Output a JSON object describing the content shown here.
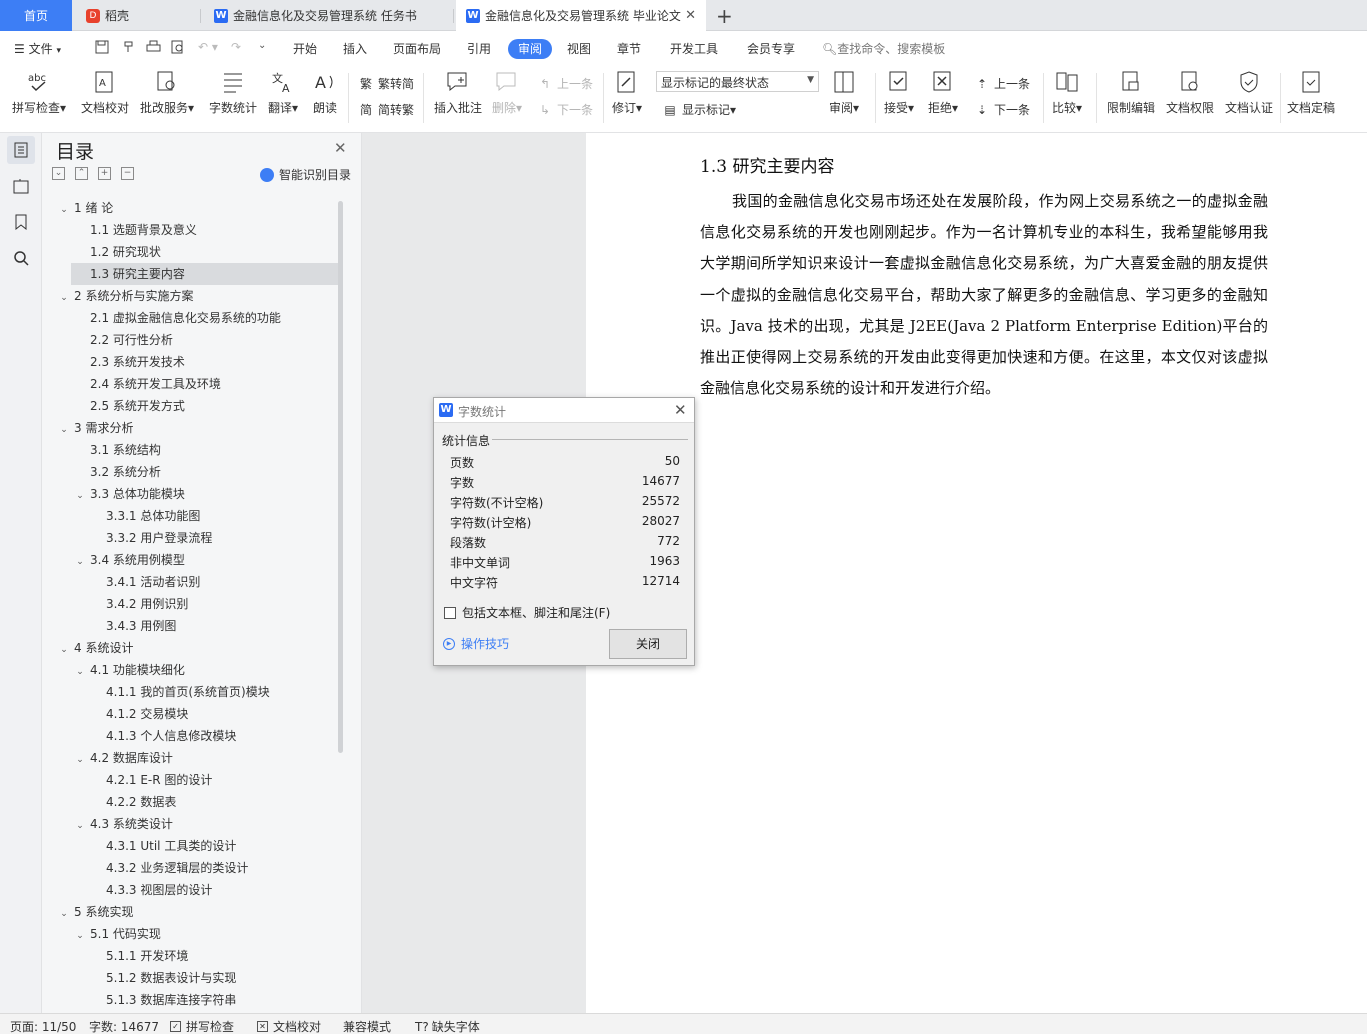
{
  "tabs": {
    "home": "首页",
    "daoke": "稻壳",
    "doc1": "金融信息化及交易管理系统 任务书",
    "doc2": "金融信息化及交易管理系统 毕业论文",
    "add": "+",
    "close": "✕"
  },
  "menu": {
    "file": "文件",
    "items": [
      "开始",
      "插入",
      "页面布局",
      "引用",
      "审阅",
      "视图",
      "章节",
      "开发工具",
      "会员专享"
    ],
    "search": "查找命令、搜索模板"
  },
  "ribbon": {
    "spell": "拼写检查",
    "proof": "文档校对",
    "batch": "批改服务",
    "wordcount": "字数统计",
    "translate": "翻译",
    "read": "朗读",
    "trad": "繁转简",
    "simp": "简转繁",
    "insert_comment": "插入批注",
    "delete": "删除",
    "prev1": "上一条",
    "next1": "下一条",
    "revise": "修订",
    "display_state": "显示标记的最终状态",
    "show_marks": "显示标记",
    "review": "审阅",
    "accept": "接受",
    "reject": "拒绝",
    "prev2": "上一条",
    "next2": "下一条",
    "compare": "比较",
    "restrict": "限制编辑",
    "perm": "文档权限",
    "cert": "文档认证",
    "final": "文档定稿"
  },
  "toc": {
    "title": "目录",
    "smart": "智能识别目录",
    "items": [
      {
        "text": "1  绪  论",
        "level": 1,
        "caret": true
      },
      {
        "text": "1.1  选题背景及意义",
        "level": 2
      },
      {
        "text": "1.2  研究现状",
        "level": 2
      },
      {
        "text": "1.3  研究主要内容",
        "level": 2,
        "selected": true
      },
      {
        "text": "2  系统分析与实施方案",
        "level": 1,
        "caret": true
      },
      {
        "text": "2.1  虚拟金融信息化交易系统的功能",
        "level": 2
      },
      {
        "text": "2.2  可行性分析",
        "level": 2
      },
      {
        "text": "2.3  系统开发技术",
        "level": 2
      },
      {
        "text": "2.4  系统开发工具及环境",
        "level": 2
      },
      {
        "text": "2.5  系统开发方式",
        "level": 2
      },
      {
        "text": "3  需求分析",
        "level": 1,
        "caret": true
      },
      {
        "text": "3.1  系统结构",
        "level": 2
      },
      {
        "text": "3.2  系统分析",
        "level": 2
      },
      {
        "text": "3.3  总体功能模块",
        "level": 2,
        "caret": true
      },
      {
        "text": "3.3.1  总体功能图",
        "level": 3
      },
      {
        "text": "3.3.2  用户登录流程",
        "level": 3
      },
      {
        "text": "3.4  系统用例模型",
        "level": 2,
        "caret": true
      },
      {
        "text": "3.4.1  活动者识别",
        "level": 3
      },
      {
        "text": "3.4.2  用例识别",
        "level": 3
      },
      {
        "text": "3.4.3  用例图",
        "level": 3
      },
      {
        "text": "4  系统设计",
        "level": 1,
        "caret": true
      },
      {
        "text": "4.1  功能模块细化",
        "level": 2,
        "caret": true
      },
      {
        "text": "4.1.1  我的首页(系统首页)模块",
        "level": 3
      },
      {
        "text": "4.1.2  交易模块",
        "level": 3
      },
      {
        "text": "4.1.3  个人信息修改模块",
        "level": 3
      },
      {
        "text": "4.2  数据库设计",
        "level": 2,
        "caret": true
      },
      {
        "text": "4.2.1 E-R 图的设计",
        "level": 3
      },
      {
        "text": "4.2.2  数据表",
        "level": 3
      },
      {
        "text": "4.3  系统类设计",
        "level": 2,
        "caret": true
      },
      {
        "text": "4.3.1 Util 工具类的设计",
        "level": 3
      },
      {
        "text": "4.3.2  业务逻辑层的类设计",
        "level": 3
      },
      {
        "text": "4.3.3  视图层的设计",
        "level": 3
      },
      {
        "text": "5  系统实现",
        "level": 1,
        "caret": true
      },
      {
        "text": "5.1 代码实现",
        "level": 2,
        "caret": true
      },
      {
        "text": "5.1.1 开发环境",
        "level": 3
      },
      {
        "text": "5.1.2  数据表设计与实现",
        "level": 3
      },
      {
        "text": "5.1.3  数据库连接字符串",
        "level": 3
      }
    ]
  },
  "document": {
    "heading": "1.3  研究主要内容",
    "paragraph": "我国的金融信息化交易市场还处在发展阶段，作为网上交易系统之一的虚拟金融信息化交易系统的开发也刚刚起步。作为一名计算机专业的本科生，我希望能够用我大学期间所学知识来设计一套虚拟金融信息化交易系统，为广大喜爱金融的朋友提供一个虚拟的金融信息化交易平台，帮助大家了解更多的金融信息、学习更多的金融知识。Java 技术的出现，尤其是 J2EE(Java 2 Platform Enterprise Edition)平台的推出正使得网上交易系统的开发由此变得更加快速和方便。在这里，本文仅对该虚拟金融信息化交易系统的设计和开发进行介绍。"
  },
  "dialog": {
    "title": "字数统计",
    "group": "统计信息",
    "stats": [
      {
        "label": "页数",
        "value": "50"
      },
      {
        "label": "字数",
        "value": "14677"
      },
      {
        "label": "字符数(不计空格)",
        "value": "25572"
      },
      {
        "label": "字符数(计空格)",
        "value": "28027"
      },
      {
        "label": "段落数",
        "value": "772"
      },
      {
        "label": "非中文单词",
        "value": "1963"
      },
      {
        "label": "中文字符",
        "value": "12714"
      }
    ],
    "checkbox": "包括文本框、脚注和尾注(F)",
    "tips": "操作技巧",
    "close_btn": "关闭"
  },
  "status": {
    "page": "页面: 11/50",
    "words": "字数: 14677",
    "spell": "拼写检查",
    "proof": "文档校对",
    "compat": "兼容模式",
    "missing_font": "缺失字体"
  },
  "colors": {
    "accent": "#3d7ef5",
    "tab_bg": "#e6e8eb"
  }
}
